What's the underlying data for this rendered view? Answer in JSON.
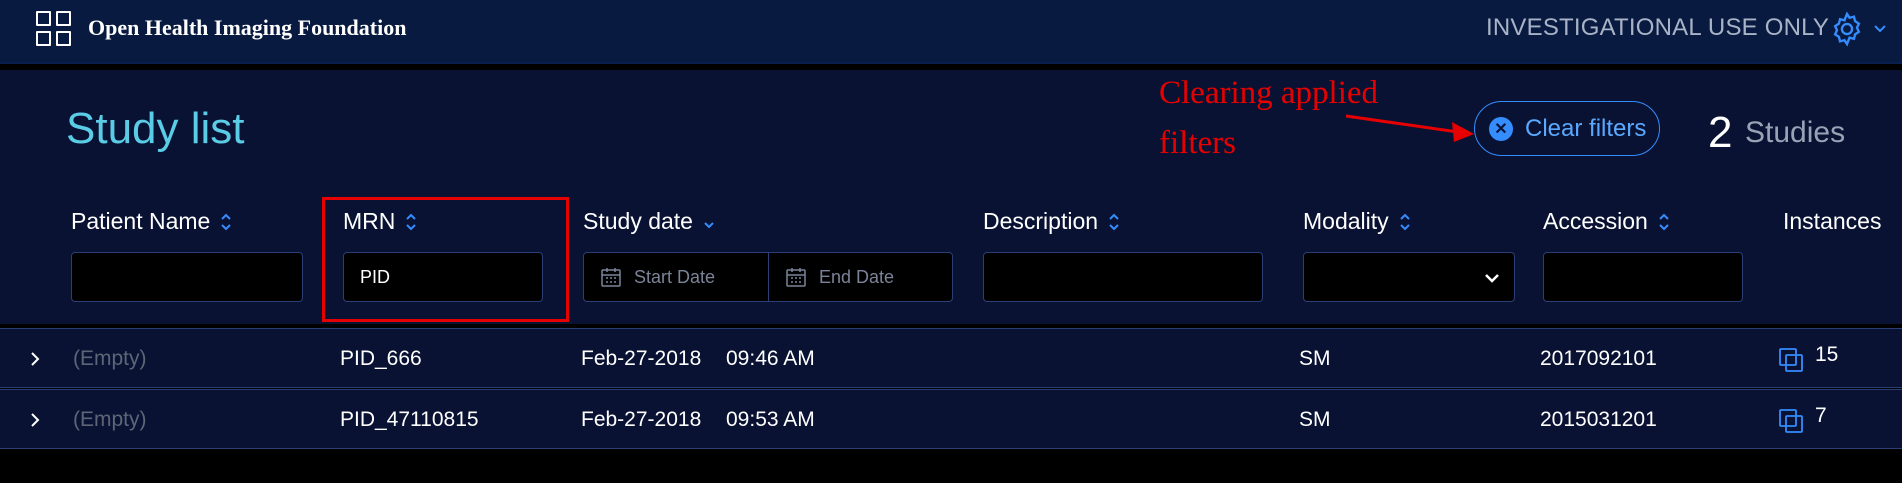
{
  "header": {
    "brand": "Open Health Imaging Foundation",
    "notice": "INVESTIGATIONAL USE ONLY",
    "icons": [
      "logo-grid-icon",
      "gear-icon",
      "chevron-down-icon"
    ]
  },
  "study_list": {
    "title": "Study list",
    "annotation": "Clearing applied filters",
    "clear_filters_label": "Clear filters",
    "count": "2",
    "count_label": "Studies"
  },
  "columns": {
    "patient_name": "Patient Name",
    "mrn": "MRN",
    "study_date": "Study date",
    "description": "Description",
    "modality": "Modality",
    "accession": "Accession",
    "instances": "Instances"
  },
  "filters": {
    "patient_name": "",
    "mrn": "PID",
    "start_date_placeholder": "Start Date",
    "end_date_placeholder": "End Date",
    "description": "",
    "modality": "",
    "accession": ""
  },
  "rows": [
    {
      "patient_name": "(Empty)",
      "mrn": "PID_666",
      "date": "Feb-27-2018",
      "time": "09:46 AM",
      "description": "",
      "modality": "SM",
      "accession": "2017092101",
      "instances": "15"
    },
    {
      "patient_name": "(Empty)",
      "mrn": "PID_47110815",
      "date": "Feb-27-2018",
      "time": "09:53 AM",
      "description": "",
      "modality": "SM",
      "accession": "2015031201",
      "instances": "7"
    }
  ],
  "colors": {
    "accent": "#5acce6",
    "primary": "#348cfd",
    "annotation": "#e60000",
    "header_bg": "#081a3f",
    "panel_bg": "#091233"
  }
}
